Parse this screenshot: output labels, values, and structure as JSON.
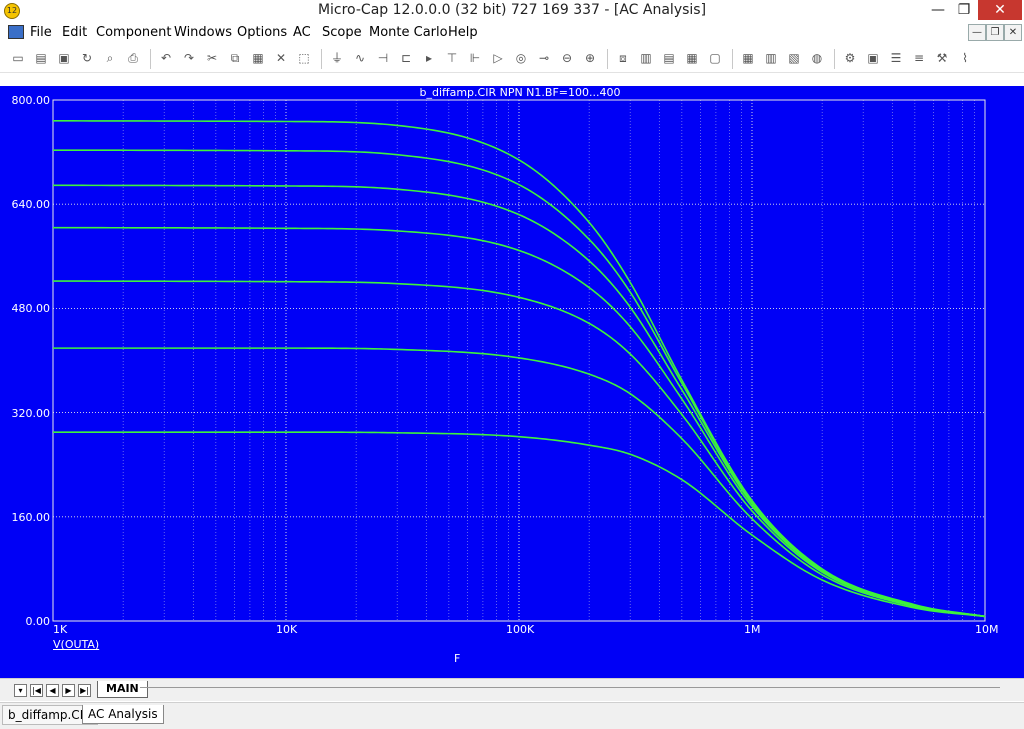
{
  "window": {
    "title": "Micro-Cap 12.0.0.0 (32 bit) 727 169 337 - [AC Analysis]",
    "app_icon_text": "12",
    "minimize_glyph": "—",
    "maximize_glyph": "❐",
    "close_glyph": "✕"
  },
  "menu": [
    "File",
    "Edit",
    "Component",
    "Windows",
    "Options",
    "AC",
    "Scope",
    "Monte Carlo",
    "Help"
  ],
  "toolbar_icons": [
    "new-file-icon",
    "open-file-icon",
    "save-icon",
    "revert-icon",
    "print-preview-icon",
    "print-icon",
    "undo-icon",
    "redo-icon",
    "cut-icon",
    "copy-icon",
    "paste-icon",
    "delete-icon",
    "select-all-icon",
    "ground-icon",
    "resistor-icon",
    "capacitor-icon",
    "inductor-icon",
    "diode-icon",
    "npn-icon",
    "nmos-icon",
    "opamp-icon",
    "source-icon",
    "battery-icon",
    "voltage-source-icon",
    "current-source-icon",
    "cascade-icon",
    "tile-vertical-icon",
    "tile-horizontal-icon",
    "tile-icon",
    "window-icon",
    "calculator-icon",
    "component-panel-icon",
    "library-icon",
    "globe-icon",
    "run-icon",
    "properties-icon",
    "limits-icon",
    "stepping-icon",
    "tools-icon",
    "plot-icon"
  ],
  "plot": {
    "title": "b_diffamp.CIR NPN N1.BF=100...400",
    "expression": "V(OUTA)",
    "x_variable": "F",
    "y_tick_labels": [
      "800.00",
      "640.00",
      "480.00",
      "320.00",
      "160.00",
      "0.00"
    ],
    "x_tick_labels": [
      "1K",
      "10K",
      "100K",
      "1M",
      "10M"
    ],
    "trace_color": "#3df23d",
    "background_color": "#0000f6",
    "grid_color": "#e8e8e8"
  },
  "chart_data": {
    "type": "line",
    "title": "b_diffamp.CIR NPN N1.BF=100...400",
    "xlabel": "F",
    "ylabel": "V(OUTA)",
    "x_scale": "log",
    "xlim": [
      1000,
      10000000
    ],
    "ylim": [
      0,
      800
    ],
    "grid": true,
    "x": [
      1000,
      10000,
      30000,
      100000,
      200000,
      300000,
      500000,
      1000000,
      2000000,
      5000000,
      10000000
    ],
    "series": [
      {
        "values": [
          768,
          767,
          761,
          708,
          612,
          520,
          370,
          185,
          80,
          25,
          7
        ]
      },
      {
        "values": [
          723,
          722,
          716,
          670,
          586,
          505,
          365,
          182,
          79,
          24,
          7
        ]
      },
      {
        "values": [
          669,
          668,
          663,
          624,
          553,
          482,
          355,
          180,
          78,
          24,
          7
        ]
      },
      {
        "values": [
          604,
          603,
          599,
          569,
          512,
          452,
          341,
          176,
          77,
          23,
          7
        ]
      },
      {
        "values": [
          522,
          521,
          518,
          497,
          457,
          410,
          317,
          169,
          75,
          23,
          7
        ]
      },
      {
        "values": [
          419,
          419,
          417,
          404,
          379,
          349,
          280,
          157,
          71,
          22,
          7
        ]
      },
      {
        "values": [
          290,
          290,
          289,
          283,
          270,
          256,
          217,
          132,
          63,
          20,
          7
        ]
      }
    ]
  },
  "tabs": {
    "page_tab": "MAIN"
  },
  "nav_glyphs": [
    "▾",
    "|◀",
    "◀",
    "▶",
    "▶|"
  ],
  "taskbar": {
    "items": [
      "b_diffamp.CIR",
      "AC Analysis"
    ]
  }
}
